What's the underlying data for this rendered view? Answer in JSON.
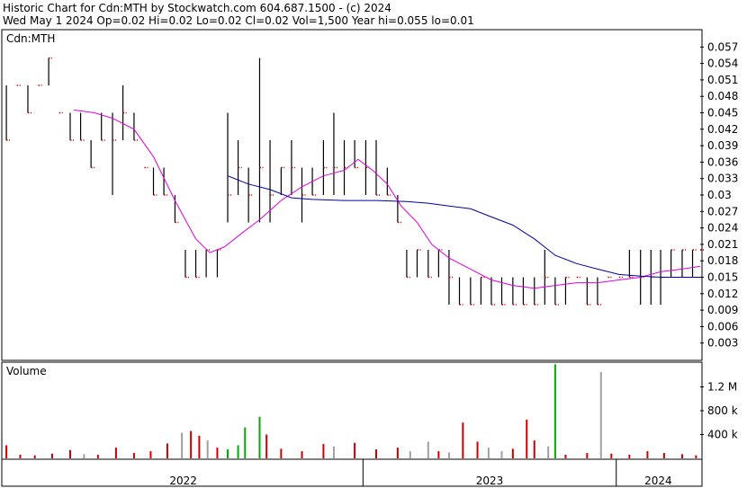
{
  "header": {
    "line1": "Historic Chart for Cdn:MTH by Stockwatch.com 604.687.1500 - (c) 2024",
    "line2": "Wed May  1 2024  Op=0.02  Hi=0.02  Lo=0.02  Cl=0.02  Vol=1,500  Year hi=0.055  lo=0.01"
  },
  "chart_data": [
    {
      "type": "bar",
      "subtype": "ohlc",
      "title": "Cdn:MTH",
      "ylim": [
        0,
        0.06
      ],
      "yticks": [
        "0.003",
        "0.006",
        "0.009",
        "0.012",
        "0.015",
        "0.018",
        "0.021",
        "0.024",
        "0.027",
        "0.03",
        "0.033",
        "0.036",
        "0.039",
        "0.042",
        "0.045",
        "0.048",
        "0.051",
        "0.054",
        "0.057"
      ],
      "ytick_values": [
        0.003,
        0.006,
        0.009,
        0.012,
        0.015,
        0.018,
        0.021,
        0.024,
        0.027,
        0.03,
        0.033,
        0.036,
        0.039,
        0.042,
        0.045,
        0.048,
        0.051,
        0.054,
        0.057
      ],
      "xticks": [
        "2022",
        "2023",
        "2024"
      ],
      "x_range": [
        "2021-08",
        "2024-05"
      ],
      "year_starts": [
        "2022-01-01",
        "2023-01-01",
        "2024-01-01"
      ],
      "grid": false,
      "colors": {
        "price": "#000000",
        "marker": "#cc0000",
        "ma_short": "#dd00dd",
        "ma_long": "#0000aa"
      },
      "bars": [
        {
          "x": "2021-08-05",
          "h": 0.05,
          "l": 0.04,
          "c": 0.04
        },
        {
          "x": "2021-08-20",
          "h": 0.05,
          "l": 0.05,
          "c": 0.05
        },
        {
          "x": "2021-09-05",
          "h": 0.05,
          "l": 0.045,
          "c": 0.045
        },
        {
          "x": "2021-09-20",
          "h": 0.05,
          "l": 0.05,
          "c": 0.05
        },
        {
          "x": "2021-10-05",
          "h": 0.055,
          "l": 0.05,
          "c": 0.055
        },
        {
          "x": "2021-10-20",
          "h": 0.045,
          "l": 0.045,
          "c": 0.045
        },
        {
          "x": "2021-11-05",
          "h": 0.045,
          "l": 0.04,
          "c": 0.04
        },
        {
          "x": "2021-11-20",
          "h": 0.045,
          "l": 0.04,
          "c": 0.04
        },
        {
          "x": "2021-12-05",
          "h": 0.04,
          "l": 0.035,
          "c": 0.035
        },
        {
          "x": "2021-12-20",
          "h": 0.045,
          "l": 0.04,
          "c": 0.04
        },
        {
          "x": "2022-01-05",
          "h": 0.045,
          "l": 0.03,
          "c": 0.04
        },
        {
          "x": "2022-01-20",
          "h": 0.05,
          "l": 0.04,
          "c": 0.045
        },
        {
          "x": "2022-02-05",
          "h": 0.045,
          "l": 0.04,
          "c": 0.04
        },
        {
          "x": "2022-02-20",
          "h": 0.035,
          "l": 0.035,
          "c": 0.035
        },
        {
          "x": "2022-03-05",
          "h": 0.035,
          "l": 0.03,
          "c": 0.03
        },
        {
          "x": "2022-03-20",
          "h": 0.035,
          "l": 0.03,
          "c": 0.03
        },
        {
          "x": "2022-04-05",
          "h": 0.03,
          "l": 0.025,
          "c": 0.025
        },
        {
          "x": "2022-04-20",
          "h": 0.02,
          "l": 0.015,
          "c": 0.015
        },
        {
          "x": "2022-05-05",
          "h": 0.02,
          "l": 0.015,
          "c": 0.015
        },
        {
          "x": "2022-05-20",
          "h": 0.02,
          "l": 0.015,
          "c": 0.02
        },
        {
          "x": "2022-06-05",
          "h": 0.02,
          "l": 0.015,
          "c": 0.02
        },
        {
          "x": "2022-06-20",
          "h": 0.045,
          "l": 0.025,
          "c": 0.03
        },
        {
          "x": "2022-07-05",
          "h": 0.04,
          "l": 0.03,
          "c": 0.035
        },
        {
          "x": "2022-07-20",
          "h": 0.035,
          "l": 0.025,
          "c": 0.03
        },
        {
          "x": "2022-08-05",
          "h": 0.055,
          "l": 0.025,
          "c": 0.035
        },
        {
          "x": "2022-08-20",
          "h": 0.04,
          "l": 0.025,
          "c": 0.03
        },
        {
          "x": "2022-09-05",
          "h": 0.035,
          "l": 0.03,
          "c": 0.035
        },
        {
          "x": "2022-09-20",
          "h": 0.04,
          "l": 0.03,
          "c": 0.035
        },
        {
          "x": "2022-10-05",
          "h": 0.035,
          "l": 0.025,
          "c": 0.03
        },
        {
          "x": "2022-10-20",
          "h": 0.035,
          "l": 0.03,
          "c": 0.03
        },
        {
          "x": "2022-11-05",
          "h": 0.04,
          "l": 0.03,
          "c": 0.035
        },
        {
          "x": "2022-11-20",
          "h": 0.045,
          "l": 0.03,
          "c": 0.035
        },
        {
          "x": "2022-12-05",
          "h": 0.04,
          "l": 0.03,
          "c": 0.035
        },
        {
          "x": "2022-12-20",
          "h": 0.04,
          "l": 0.035,
          "c": 0.035
        },
        {
          "x": "2023-01-05",
          "h": 0.04,
          "l": 0.03,
          "c": 0.035
        },
        {
          "x": "2023-01-20",
          "h": 0.04,
          "l": 0.03,
          "c": 0.03
        },
        {
          "x": "2023-02-05",
          "h": 0.035,
          "l": 0.03,
          "c": 0.03
        },
        {
          "x": "2023-02-20",
          "h": 0.03,
          "l": 0.025,
          "c": 0.025
        },
        {
          "x": "2023-03-05",
          "h": 0.02,
          "l": 0.015,
          "c": 0.015
        },
        {
          "x": "2023-03-20",
          "h": 0.02,
          "l": 0.015,
          "c": 0.02
        },
        {
          "x": "2023-04-05",
          "h": 0.02,
          "l": 0.015,
          "c": 0.015
        },
        {
          "x": "2023-04-20",
          "h": 0.02,
          "l": 0.015,
          "c": 0.02
        },
        {
          "x": "2023-05-05",
          "h": 0.02,
          "l": 0.01,
          "c": 0.015
        },
        {
          "x": "2023-05-20",
          "h": 0.015,
          "l": 0.01,
          "c": 0.01
        },
        {
          "x": "2023-06-05",
          "h": 0.015,
          "l": 0.01,
          "c": 0.01
        },
        {
          "x": "2023-06-20",
          "h": 0.015,
          "l": 0.01,
          "c": 0.015
        },
        {
          "x": "2023-07-05",
          "h": 0.015,
          "l": 0.01,
          "c": 0.01
        },
        {
          "x": "2023-07-20",
          "h": 0.015,
          "l": 0.01,
          "c": 0.01
        },
        {
          "x": "2023-08-05",
          "h": 0.015,
          "l": 0.01,
          "c": 0.01
        },
        {
          "x": "2023-08-20",
          "h": 0.015,
          "l": 0.01,
          "c": 0.01
        },
        {
          "x": "2023-09-05",
          "h": 0.015,
          "l": 0.01,
          "c": 0.01
        },
        {
          "x": "2023-09-20",
          "h": 0.02,
          "l": 0.01,
          "c": 0.015
        },
        {
          "x": "2023-10-05",
          "h": 0.015,
          "l": 0.01,
          "c": 0.01
        },
        {
          "x": "2023-10-20",
          "h": 0.015,
          "l": 0.01,
          "c": 0.015
        },
        {
          "x": "2023-11-05",
          "h": 0.015,
          "l": 0.015,
          "c": 0.015
        },
        {
          "x": "2023-11-20",
          "h": 0.015,
          "l": 0.01,
          "c": 0.01
        },
        {
          "x": "2023-12-05",
          "h": 0.015,
          "l": 0.01,
          "c": 0.01
        },
        {
          "x": "2023-12-20",
          "h": 0.015,
          "l": 0.015,
          "c": 0.015
        },
        {
          "x": "2024-01-05",
          "h": 0.015,
          "l": 0.015,
          "c": 0.015
        },
        {
          "x": "2024-01-20",
          "h": 0.02,
          "l": 0.015,
          "c": 0.015
        },
        {
          "x": "2024-02-05",
          "h": 0.02,
          "l": 0.01,
          "c": 0.015
        },
        {
          "x": "2024-02-20",
          "h": 0.02,
          "l": 0.01,
          "c": 0.015
        },
        {
          "x": "2024-03-05",
          "h": 0.02,
          "l": 0.01,
          "c": 0.015
        },
        {
          "x": "2024-03-20",
          "h": 0.02,
          "l": 0.015,
          "c": 0.02
        },
        {
          "x": "2024-04-05",
          "h": 0.02,
          "l": 0.015,
          "c": 0.02
        },
        {
          "x": "2024-04-20",
          "h": 0.02,
          "l": 0.015,
          "c": 0.02
        },
        {
          "x": "2024-05-01",
          "h": 0.02,
          "l": 0.02,
          "c": 0.02
        }
      ],
      "ma_short": [
        [
          "2021-11-10",
          0.0455
        ],
        [
          "2021-12-10",
          0.045
        ],
        [
          "2022-01-05",
          0.044
        ],
        [
          "2022-02-05",
          0.042
        ],
        [
          "2022-03-05",
          0.037
        ],
        [
          "2022-04-05",
          0.029
        ],
        [
          "2022-05-05",
          0.022
        ],
        [
          "2022-05-25",
          0.0195
        ],
        [
          "2022-06-15",
          0.0205
        ],
        [
          "2022-07-10",
          0.023
        ],
        [
          "2022-08-05",
          0.0255
        ],
        [
          "2022-09-05",
          0.029
        ],
        [
          "2022-10-05",
          0.0315
        ],
        [
          "2022-11-05",
          0.0335
        ],
        [
          "2022-12-05",
          0.0345
        ],
        [
          "2022-12-25",
          0.0365
        ],
        [
          "2023-01-15",
          0.0345
        ],
        [
          "2023-02-05",
          0.032
        ],
        [
          "2023-02-25",
          0.028
        ],
        [
          "2023-03-20",
          0.025
        ],
        [
          "2023-04-10",
          0.021
        ],
        [
          "2023-05-05",
          0.0185
        ],
        [
          "2023-06-05",
          0.0165
        ],
        [
          "2023-07-05",
          0.0145
        ],
        [
          "2023-08-05",
          0.0135
        ],
        [
          "2023-09-05",
          0.013
        ],
        [
          "2023-10-05",
          0.0135
        ],
        [
          "2023-11-05",
          0.014
        ],
        [
          "2023-12-05",
          0.014
        ],
        [
          "2024-01-05",
          0.0145
        ],
        [
          "2024-02-05",
          0.015
        ],
        [
          "2024-03-05",
          0.016
        ],
        [
          "2024-04-05",
          0.0165
        ],
        [
          "2024-05-01",
          0.017
        ]
      ],
      "ma_long": [
        [
          "2022-06-20",
          0.0335
        ],
        [
          "2022-07-20",
          0.032
        ],
        [
          "2022-08-20",
          0.031
        ],
        [
          "2022-09-20",
          0.0295
        ],
        [
          "2022-10-20",
          0.0292
        ],
        [
          "2022-12-05",
          0.029
        ],
        [
          "2023-01-20",
          0.029
        ],
        [
          "2023-03-05",
          0.0288
        ],
        [
          "2023-04-05",
          0.0285
        ],
        [
          "2023-05-05",
          0.028
        ],
        [
          "2023-06-05",
          0.0275
        ],
        [
          "2023-07-05",
          0.026
        ],
        [
          "2023-08-05",
          0.0245
        ],
        [
          "2023-09-05",
          0.022
        ],
        [
          "2023-10-05",
          0.019
        ],
        [
          "2023-11-05",
          0.0175
        ],
        [
          "2023-12-05",
          0.0165
        ],
        [
          "2024-01-05",
          0.0155
        ],
        [
          "2024-02-05",
          0.0152
        ],
        [
          "2024-03-05",
          0.015
        ],
        [
          "2024-04-05",
          0.015
        ],
        [
          "2024-05-01",
          0.015
        ]
      ]
    },
    {
      "type": "bar",
      "title": "Volume",
      "ylim": [
        0,
        1600000
      ],
      "yticks": [
        "400 k",
        "800 k",
        "1.2 M"
      ],
      "ytick_values": [
        400000,
        800000,
        1200000
      ],
      "xticks": [
        "2022",
        "2023",
        "2024"
      ],
      "colors": {
        "up": "#00aa00",
        "down": "#cc0000",
        "flat": "#a0a0a0"
      },
      "bars": [
        {
          "x": "2021-08-05",
          "v": 220000,
          "c": "down"
        },
        {
          "x": "2021-08-25",
          "v": 60000,
          "c": "down"
        },
        {
          "x": "2021-09-15",
          "v": 50000,
          "c": "down"
        },
        {
          "x": "2021-10-10",
          "v": 80000,
          "c": "down"
        },
        {
          "x": "2021-11-05",
          "v": 140000,
          "c": "down"
        },
        {
          "x": "2021-11-25",
          "v": 70000,
          "c": "flat"
        },
        {
          "x": "2021-12-15",
          "v": 60000,
          "c": "down"
        },
        {
          "x": "2022-01-10",
          "v": 180000,
          "c": "down"
        },
        {
          "x": "2022-02-05",
          "v": 90000,
          "c": "down"
        },
        {
          "x": "2022-03-01",
          "v": 120000,
          "c": "down"
        },
        {
          "x": "2022-03-25",
          "v": 250000,
          "c": "down"
        },
        {
          "x": "2022-04-15",
          "v": 430000,
          "c": "flat"
        },
        {
          "x": "2022-04-28",
          "v": 460000,
          "c": "down"
        },
        {
          "x": "2022-05-10",
          "v": 380000,
          "c": "down"
        },
        {
          "x": "2022-05-22",
          "v": 300000,
          "c": "flat"
        },
        {
          "x": "2022-06-05",
          "v": 180000,
          "c": "down"
        },
        {
          "x": "2022-06-20",
          "v": 150000,
          "c": "up"
        },
        {
          "x": "2022-07-05",
          "v": 220000,
          "c": "up"
        },
        {
          "x": "2022-07-15",
          "v": 520000,
          "c": "up"
        },
        {
          "x": "2022-08-05",
          "v": 700000,
          "c": "up"
        },
        {
          "x": "2022-08-15",
          "v": 400000,
          "c": "down"
        },
        {
          "x": "2022-09-05",
          "v": 160000,
          "c": "down"
        },
        {
          "x": "2022-10-05",
          "v": 120000,
          "c": "down"
        },
        {
          "x": "2022-11-05",
          "v": 240000,
          "c": "down"
        },
        {
          "x": "2022-11-20",
          "v": 200000,
          "c": "flat"
        },
        {
          "x": "2022-12-20",
          "v": 260000,
          "c": "down"
        },
        {
          "x": "2023-01-20",
          "v": 150000,
          "c": "down"
        },
        {
          "x": "2023-02-20",
          "v": 180000,
          "c": "down"
        },
        {
          "x": "2023-03-10",
          "v": 120000,
          "c": "flat"
        },
        {
          "x": "2023-04-05",
          "v": 280000,
          "c": "flat"
        },
        {
          "x": "2023-04-20",
          "v": 120000,
          "c": "down"
        },
        {
          "x": "2023-05-05",
          "v": 100000,
          "c": "flat"
        },
        {
          "x": "2023-05-25",
          "v": 600000,
          "c": "down"
        },
        {
          "x": "2023-06-15",
          "v": 280000,
          "c": "down"
        },
        {
          "x": "2023-07-01",
          "v": 180000,
          "c": "flat"
        },
        {
          "x": "2023-07-20",
          "v": 120000,
          "c": "flat"
        },
        {
          "x": "2023-08-05",
          "v": 160000,
          "c": "down"
        },
        {
          "x": "2023-08-25",
          "v": 650000,
          "c": "down"
        },
        {
          "x": "2023-09-05",
          "v": 300000,
          "c": "down"
        },
        {
          "x": "2023-09-25",
          "v": 200000,
          "c": "flat"
        },
        {
          "x": "2023-10-05",
          "v": 1580000,
          "c": "up"
        },
        {
          "x": "2023-10-20",
          "v": 60000,
          "c": "down"
        },
        {
          "x": "2023-11-20",
          "v": 90000,
          "c": "down"
        },
        {
          "x": "2023-12-10",
          "v": 1450000,
          "c": "flat"
        },
        {
          "x": "2023-12-25",
          "v": 80000,
          "c": "down"
        },
        {
          "x": "2024-01-20",
          "v": 60000,
          "c": "down"
        },
        {
          "x": "2024-02-15",
          "v": 120000,
          "c": "down"
        },
        {
          "x": "2024-03-10",
          "v": 90000,
          "c": "down"
        },
        {
          "x": "2024-04-05",
          "v": 70000,
          "c": "down"
        },
        {
          "x": "2024-04-25",
          "v": 50000,
          "c": "down"
        }
      ]
    }
  ]
}
